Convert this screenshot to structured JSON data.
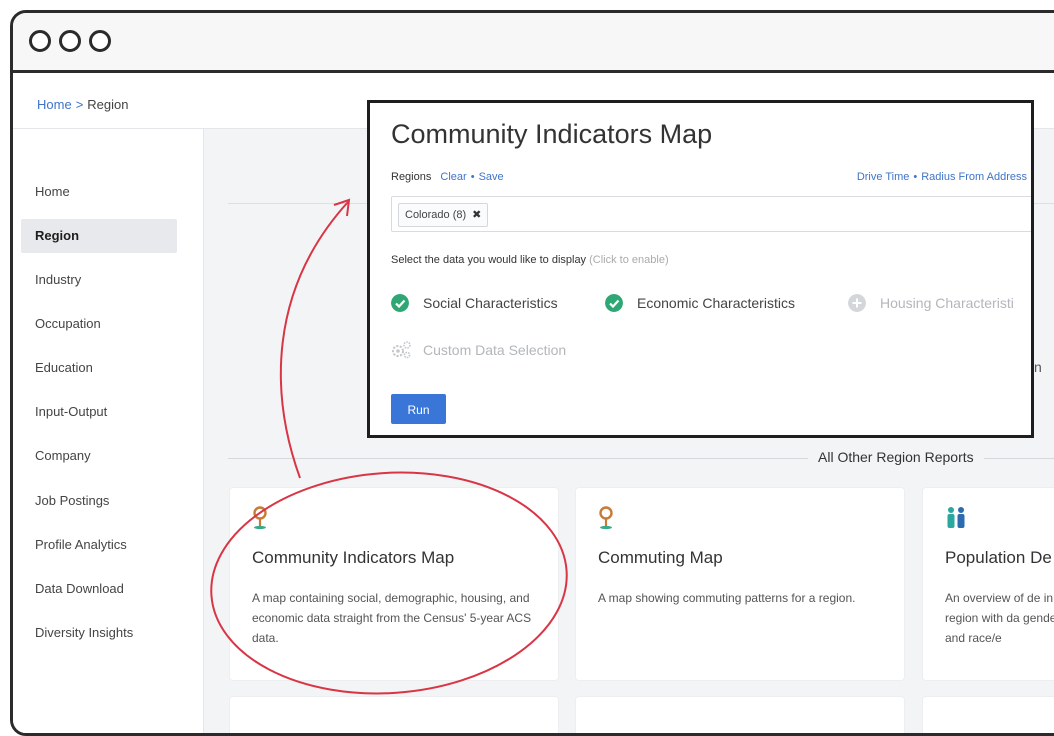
{
  "window": {
    "controls": [
      "close",
      "minimize",
      "maximize"
    ]
  },
  "breadcrumb": {
    "home": "Home",
    "separator": ">",
    "current": "Region"
  },
  "sidebar": {
    "items": [
      {
        "label": "Home",
        "active": false
      },
      {
        "label": "Region",
        "active": true
      },
      {
        "label": "Industry",
        "active": false
      },
      {
        "label": "Occupation",
        "active": false
      },
      {
        "label": "Education",
        "active": false
      },
      {
        "label": "Input-Output",
        "active": false
      },
      {
        "label": "Company",
        "active": false
      },
      {
        "label": "Job Postings",
        "active": false
      },
      {
        "label": "Profile Analytics",
        "active": false
      },
      {
        "label": "Data Download",
        "active": false
      },
      {
        "label": "Diversity Insights",
        "active": false
      }
    ]
  },
  "popup": {
    "title": "Community Indicators Map",
    "regions_label": "Regions",
    "clear_link": "Clear",
    "link_separator": "•",
    "save_link": "Save",
    "drive_time_link": "Drive Time",
    "radius_link": "Radius From Address",
    "selected_region": "Colorado (8)",
    "remove_symbol": "✖",
    "prompt": "Select the data you would like to display",
    "prompt_hint": "(Click to enable)",
    "options": [
      {
        "label": "Social Characteristics",
        "enabled": true
      },
      {
        "label": "Economic Characteristics",
        "enabled": true
      },
      {
        "label": "Housing Characteristi",
        "enabled": false
      }
    ],
    "custom_selection": "Custom Data Selection",
    "run_label": "Run"
  },
  "behind_popup": {
    "partial_text": "n"
  },
  "section": {
    "title": "All Other Region Reports"
  },
  "cards": [
    {
      "icon": "map-pin-icon",
      "title": "Community Indicators Map",
      "description": "A map containing social, demographic, housing, and economic data straight from the Census' 5-year ACS data."
    },
    {
      "icon": "map-pin-icon",
      "title": "Commuting Map",
      "description": "A map showing commuting patterns for a region."
    },
    {
      "icon": "people-icon",
      "title": "Population De",
      "description": "An overview of de in a region with da gender, and race/e"
    }
  ],
  "colors": {
    "accent_blue": "#3a76d8",
    "link_blue": "#3f74c8",
    "check_green": "#2fa774",
    "annotation_red": "#d83545",
    "pin_orange": "#c97a34",
    "people_teal": "#2aa8a0"
  }
}
